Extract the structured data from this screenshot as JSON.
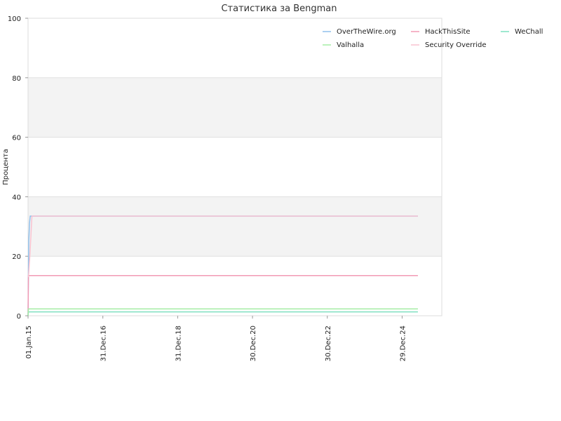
{
  "chart_data": {
    "type": "line",
    "title": "Статистика за Bengman",
    "xlabel": "",
    "ylabel": "Процента",
    "ylim": [
      0,
      100
    ],
    "yticks": [
      0,
      20,
      40,
      60,
      80,
      100
    ],
    "grid": "horizontal bands",
    "legend_position": "top-right",
    "xlim": [
      "2015-01-01",
      "2026-01-20"
    ],
    "xticks": [
      {
        "date": "2015-01-01",
        "label": "01.Jan.15"
      },
      {
        "date": "2016-12-31",
        "label": "31.Dec.16"
      },
      {
        "date": "2018-12-31",
        "label": "31.Dec.18"
      },
      {
        "date": "2020-12-30",
        "label": "30.Dec.20"
      },
      {
        "date": "2022-12-30",
        "label": "30.Dec.22"
      },
      {
        "date": "2024-12-29",
        "label": "29.Dec.24"
      }
    ],
    "series": [
      {
        "name": "OverTheWire.org",
        "color": "#90c0ec",
        "points": [
          [
            "2015-01-01",
            0
          ],
          [
            "2015-01-08",
            25
          ],
          [
            "2015-01-15",
            31
          ],
          [
            "2015-01-22",
            33.5
          ],
          [
            "2025-06-01",
            33.5
          ]
        ]
      },
      {
        "name": "HackThisSite",
        "color": "#f29ab4",
        "points": [
          [
            "2015-01-01",
            0
          ],
          [
            "2015-01-05",
            13.5
          ],
          [
            "2025-06-01",
            13.5
          ]
        ]
      },
      {
        "name": "WeChall",
        "color": "#7ee0c0",
        "points": [
          [
            "2015-01-01",
            0
          ],
          [
            "2015-01-05",
            1.3
          ],
          [
            "2025-06-01",
            1.3
          ]
        ]
      },
      {
        "name": "Valhalla",
        "color": "#a6eda6",
        "points": [
          [
            "2015-01-01",
            0
          ],
          [
            "2015-01-05",
            2.3
          ],
          [
            "2025-06-01",
            2.3
          ]
        ]
      },
      {
        "name": "Security Override",
        "color": "#f9c2d0",
        "points": [
          [
            "2015-01-05",
            13
          ],
          [
            "2015-01-20",
            21
          ],
          [
            "2015-02-01",
            29
          ],
          [
            "2015-02-08",
            33.5
          ],
          [
            "2025-06-01",
            33.5
          ]
        ]
      }
    ]
  }
}
